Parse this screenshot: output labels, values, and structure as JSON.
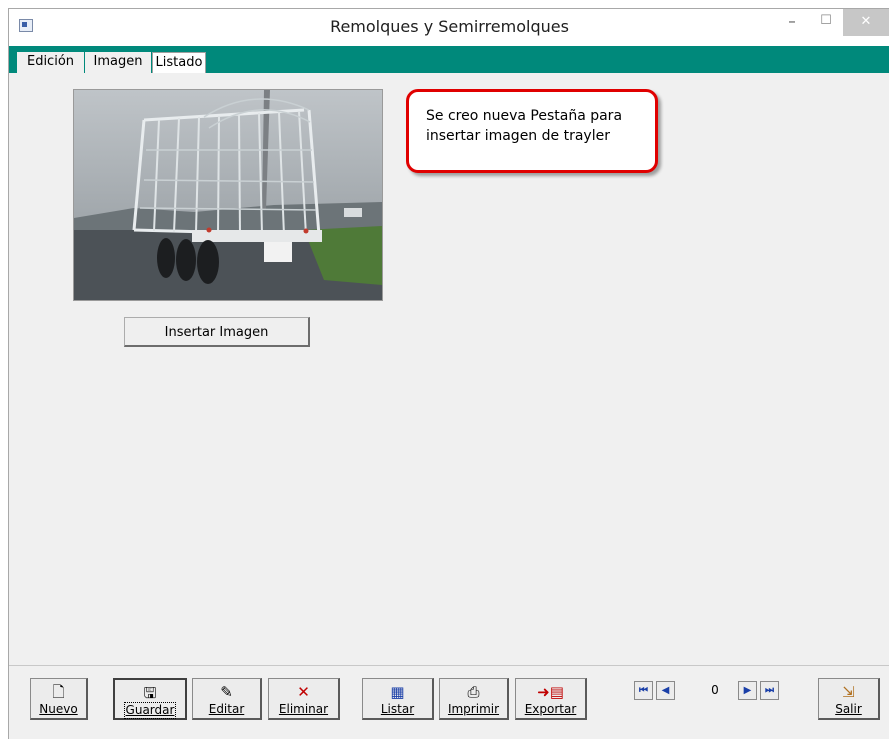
{
  "window": {
    "title": "Remolques y Semirremolques",
    "minimize": "–",
    "maximize": "☐",
    "close": "✕"
  },
  "tabs": [
    "Edición",
    "Imagen",
    "Listado"
  ],
  "image_tab": {
    "insert_button": "Insertar Imagen",
    "callout_line1": "Se creo nueva Pestaña para",
    "callout_line2": "insertar imagen de trayler"
  },
  "toolbar": {
    "nuevo": "Nuevo",
    "guardar": "Guardar",
    "editar": "Editar",
    "eliminar": "Eliminar",
    "listar": "Listar",
    "imprimir": "Imprimir",
    "exportar": "Exportar",
    "salir": "Salir"
  },
  "navigator": {
    "first": "⏮",
    "prev": "◀",
    "record": "0",
    "next": "▶",
    "last": "⏭"
  },
  "colors": {
    "accent": "#00897b",
    "callout_border": "#e00000"
  }
}
